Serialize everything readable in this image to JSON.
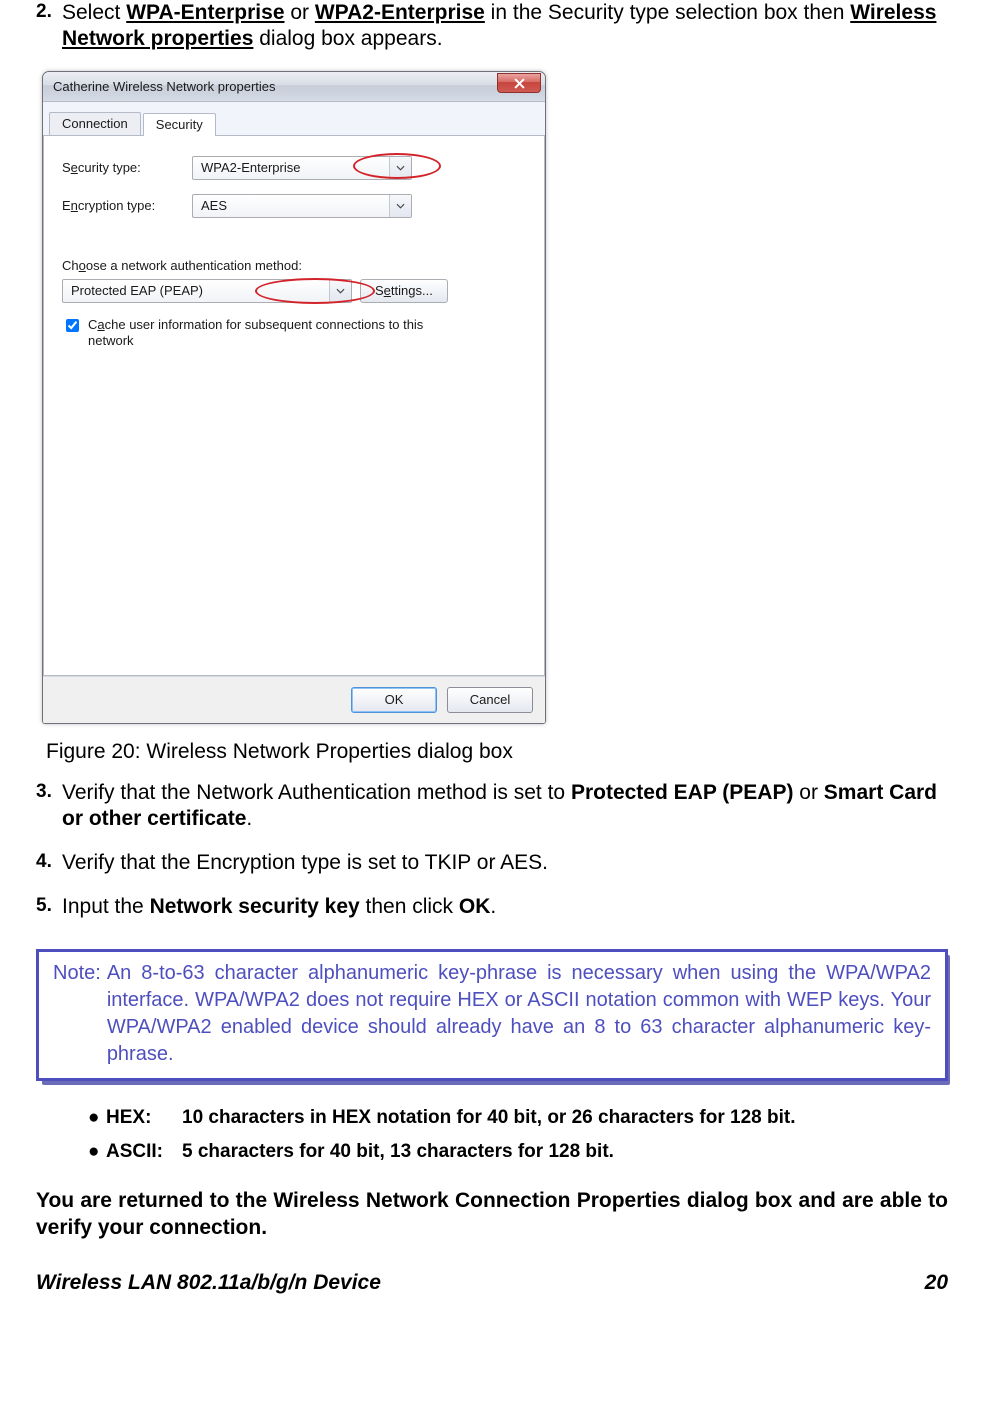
{
  "step2": {
    "num": "2.",
    "pre": "Select ",
    "opt1": "WPA-Enterprise",
    "mid1": " or ",
    "opt2": "WPA2-Enterprise",
    "mid2": " in the Security type selection box then ",
    "dlg": "Wireless Network properties",
    "post": " dialog box appears."
  },
  "dialog": {
    "title": "Catherine Wireless Network properties",
    "tab_connection": "Connection",
    "tab_security": "Security",
    "sec_type_prefix": "S",
    "sec_type_ul": "e",
    "sec_type_suffix": "curity type:",
    "sec_type_value": "WPA2-Enterprise",
    "enc_type_prefix": "E",
    "enc_type_ul": "n",
    "enc_type_suffix": "cryption type:",
    "enc_type_value": "AES",
    "method_prefix": "Ch",
    "method_ul": "o",
    "method_suffix": "ose a network authentication method:",
    "method_value": "Protected EAP (PEAP)",
    "settings_prefix": "S",
    "settings_ul": "e",
    "settings_suffix": "ttings...",
    "cache_prefix": "C",
    "cache_ul": "a",
    "cache_suffix": "che user information for subsequent connections to this network",
    "ok": "OK",
    "cancel": "Cancel"
  },
  "fig_caption": "Figure 20: Wireless Network Properties dialog box",
  "step3": {
    "num": "3.",
    "pre": "Verify that the Network Authentication method is set to ",
    "opt1": "Protected EAP (PEAP)",
    "mid": " or ",
    "opt2": "Smart Card or other certificate",
    "post": "."
  },
  "step4": {
    "num": "4.",
    "text": "Verify that the Encryption type is set to TKIP or AES."
  },
  "step5": {
    "num": "5.",
    "pre": "Input the ",
    "key": "Network security key",
    "mid": " then click ",
    "ok": "OK",
    "post": "."
  },
  "note": {
    "label": "Note:",
    "body": "An 8-to-63 character alphanumeric key-phrase is necessary when using the WPA/WPA2 interface. WPA/WPA2 does not require HEX or ASCII notation common with WEP keys. Your WPA/WPA2 enabled device should already have an 8 to 63 character alphanumeric key-phrase."
  },
  "bullets": {
    "hex_label": "HEX:",
    "hex_text": "10 characters in HEX notation for 40 bit, or 26 characters for 128 bit.",
    "ascii_label": "ASCII:",
    "ascii_text": "5 characters for 40 bit, 13 characters for 128 bit."
  },
  "returned": "You are returned to the Wireless Network Connection Properties dialog box and are able to verify your connection.",
  "footer": {
    "left": "Wireless LAN 802.11a/b/g/n Device",
    "right": "20"
  }
}
